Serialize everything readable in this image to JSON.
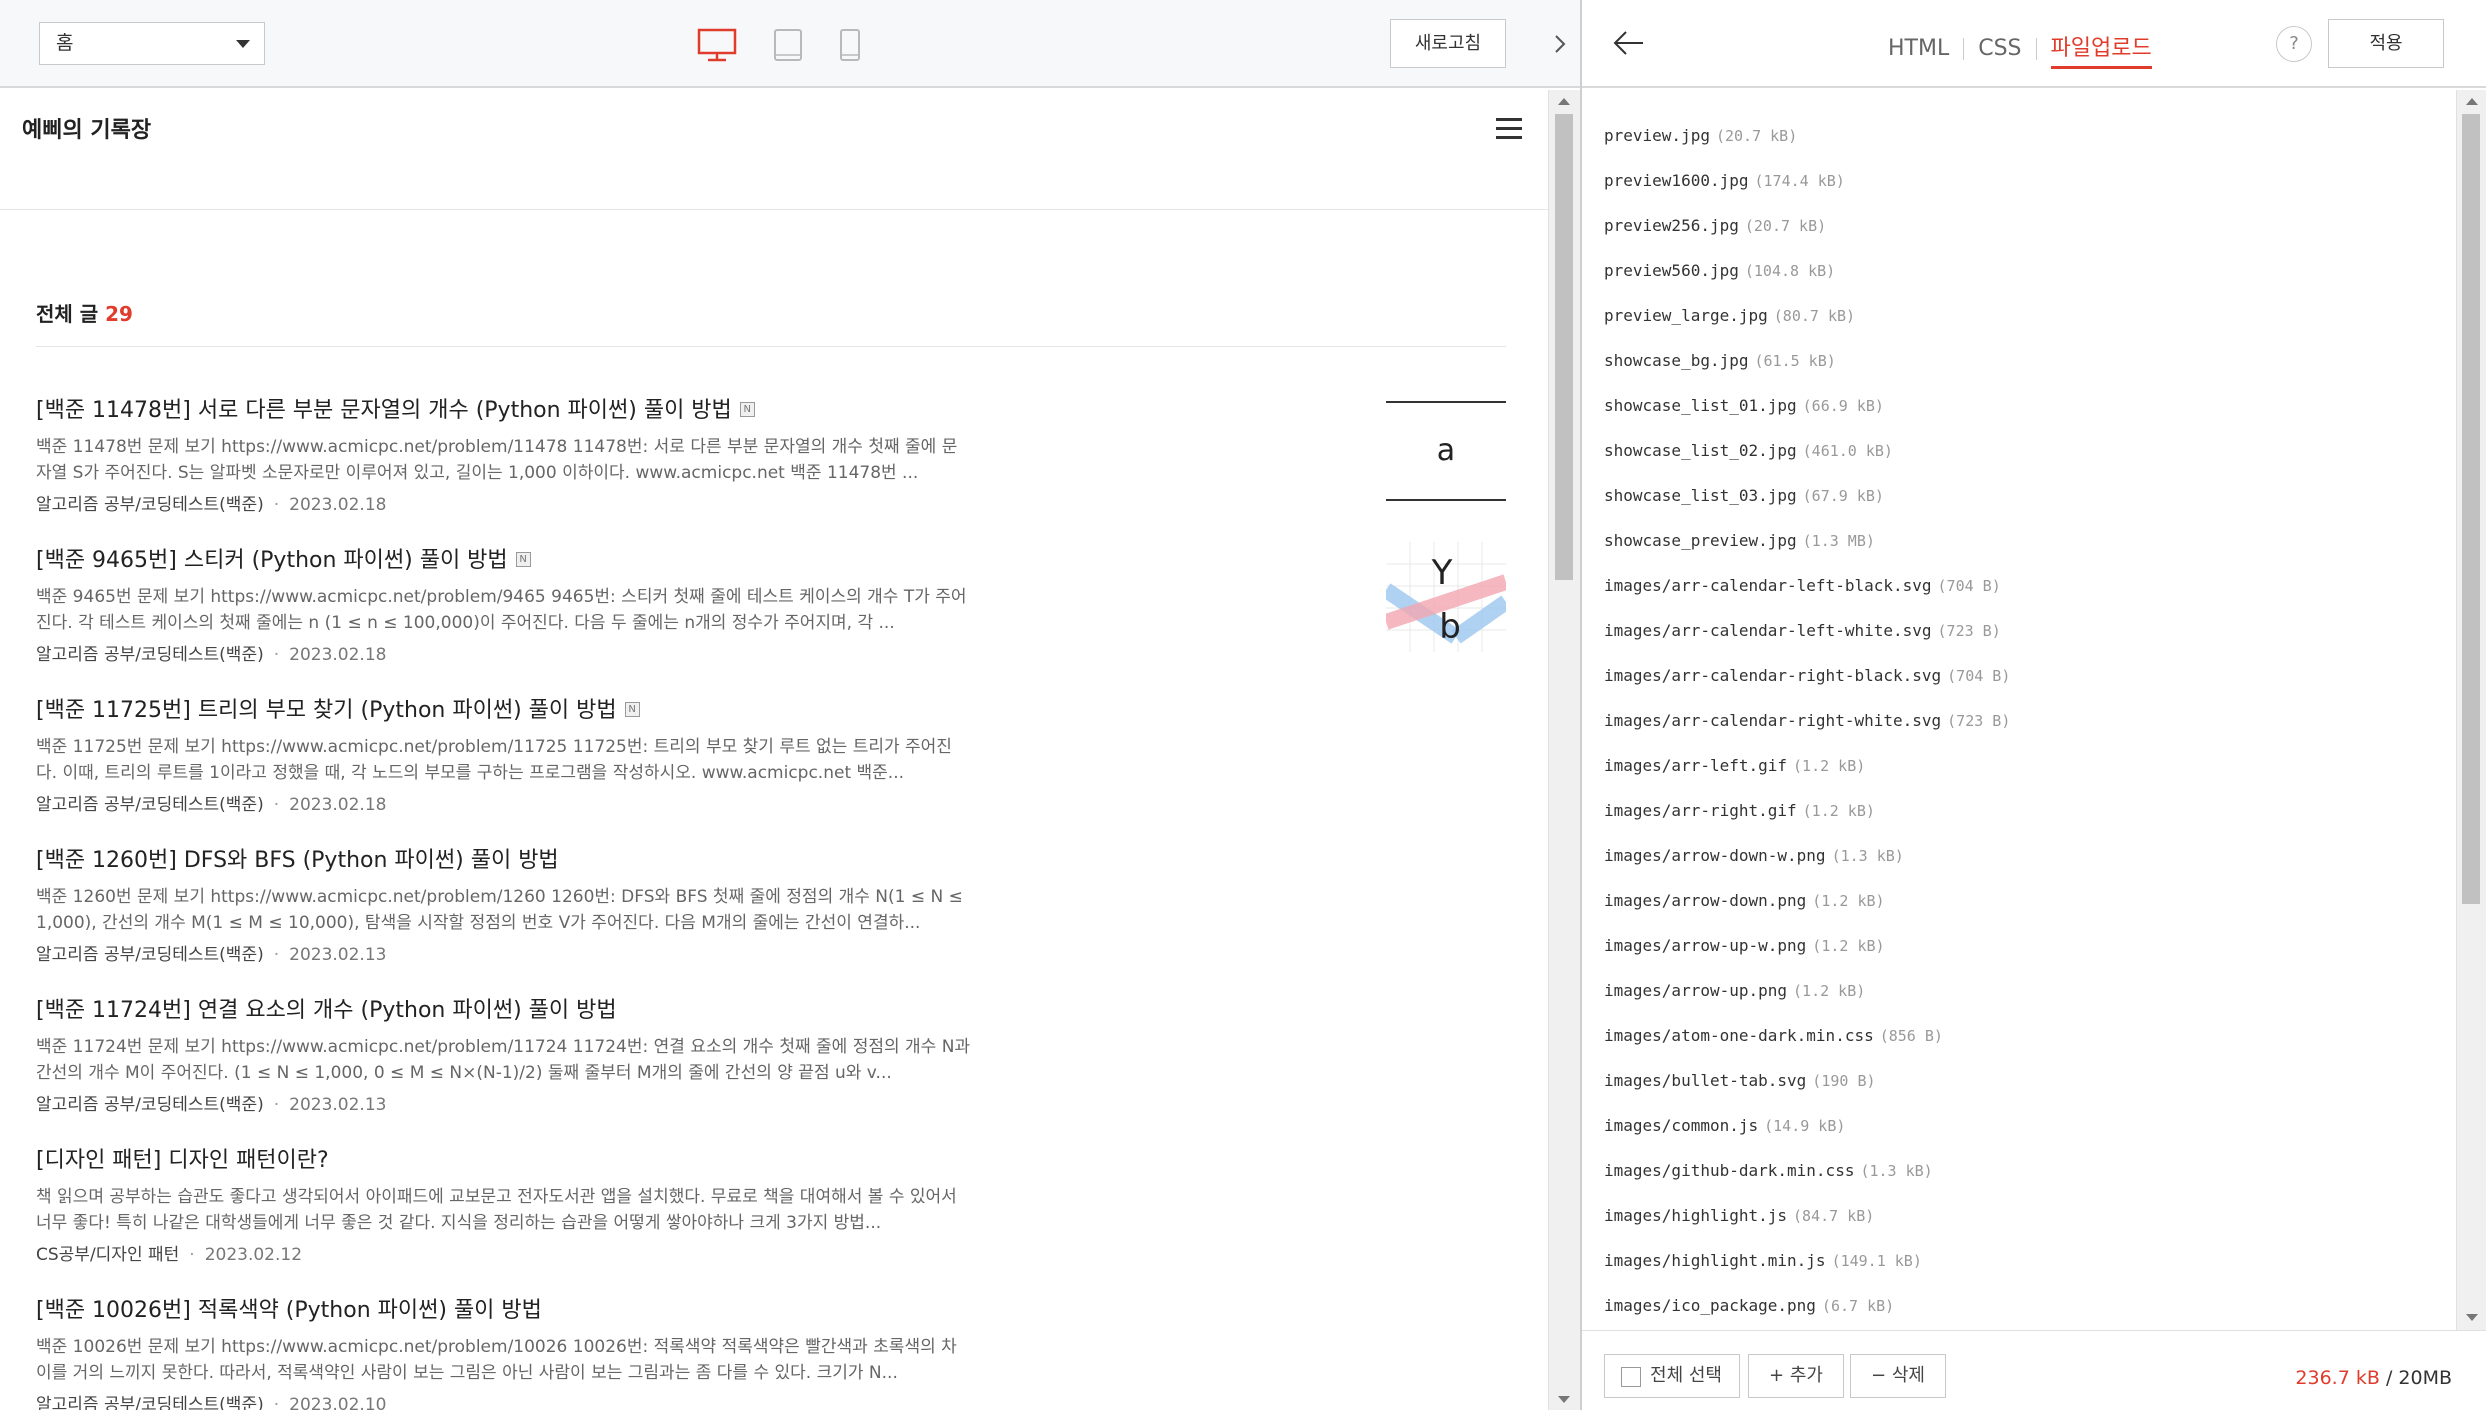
{
  "toolbar": {
    "page_select": "홈",
    "refresh_label": "새로고침"
  },
  "blog": {
    "title": "예삐의 기록장",
    "total_label": "전체 글",
    "total_count": "29",
    "posts": [
      {
        "title": "[백준 11478번] 서로 다른 부분 문자열의 개수 (Python 파이썬) 풀이 방법",
        "excerpt": "백준 11478번 문제 보기 https://www.acmicpc.net/problem/11478 11478번: 서로 다른 부분 문자열의 개수 첫째 줄에 문자열 S가 주어진다. S는 알파벳 소문자로만 이루어져 있고, 길이는 1,000 이하이다. www.acmicpc.net 백준 11478번 ...",
        "category": "알고리즘 공부/코딩테스트(백준)",
        "date": "2023.02.18",
        "new_badge": "N",
        "thumb_text": "a"
      },
      {
        "title": "[백준 9465번] 스티커 (Python 파이썬) 풀이 방법",
        "excerpt": "백준 9465번 문제 보기 https://www.acmicpc.net/problem/9465 9465번: 스티커 첫째 줄에 테스트 케이스의 개수 T가 주어진다. 각 테스트 케이스의 첫째 줄에는 n (1 ≤ n ≤ 100,000)이 주어진다. 다음 두 줄에는 n개의 정수가 주어지며, 각 ...",
        "category": "알고리즘 공부/코딩테스트(백준)",
        "date": "2023.02.18",
        "new_badge": "N",
        "thumb_top": "Y",
        "thumb_bottom": "b"
      },
      {
        "title": "[백준 11725번] 트리의 부모 찾기 (Python 파이썬) 풀이 방법",
        "excerpt": "백준 11725번 문제 보기 https://www.acmicpc.net/problem/11725 11725번: 트리의 부모 찾기 루트 없는 트리가 주어진다. 이때, 트리의 루트를 1이라고 정했을 때, 각 노드의 부모를 구하는 프로그램을 작성하시오. www.acmicpc.net 백준...",
        "category": "알고리즘 공부/코딩테스트(백준)",
        "date": "2023.02.18",
        "new_badge": "N"
      },
      {
        "title": "[백준 1260번] DFS와 BFS (Python 파이썬) 풀이 방법",
        "excerpt": "백준 1260번 문제 보기 https://www.acmicpc.net/problem/1260 1260번: DFS와 BFS 첫째 줄에 정점의 개수 N(1 ≤ N ≤ 1,000), 간선의 개수 M(1 ≤ M ≤ 10,000), 탐색을 시작할 정점의 번호 V가 주어진다. 다음 M개의 줄에는 간선이 연결하...",
        "category": "알고리즘 공부/코딩테스트(백준)",
        "date": "2023.02.13"
      },
      {
        "title": "[백준 11724번] 연결 요소의 개수 (Python 파이썬) 풀이 방법",
        "excerpt": "백준 11724번 문제 보기 https://www.acmicpc.net/problem/11724 11724번: 연결 요소의 개수 첫째 줄에 정점의 개수 N과 간선의 개수 M이 주어진다. (1 ≤ N ≤ 1,000, 0 ≤ M ≤ N×(N-1)/2) 둘째 줄부터 M개의 줄에 간선의 양 끝점 u와 v...",
        "category": "알고리즘 공부/코딩테스트(백준)",
        "date": "2023.02.13"
      },
      {
        "title": "[디자인 패턴] 디자인 패턴이란?",
        "excerpt": "책 읽으며 공부하는 습관도 좋다고 생각되어서 아이패드에 교보문고 전자도서관 앱을 설치했다. 무료로 책을 대여해서 볼 수 있어서 너무 좋다! 특히 나같은 대학생들에게 너무 좋은 것 같다. 지식을 정리하는 습관을 어떻게 쌓아야하나 크게 3가지 방법...",
        "category": "CS공부/디자인 패턴",
        "date": "2023.02.12"
      },
      {
        "title": "[백준 10026번] 적록색약 (Python 파이썬) 풀이 방법",
        "excerpt": "백준 10026번 문제 보기 https://www.acmicpc.net/problem/10026 10026번: 적록색약 적록색약은 빨간색과 초록색의 차이를 거의 느끼지 못한다. 따라서, 적록색약인 사람이 보는 그림은 아닌 사람이 보는 그림과는 좀 다를 수 있다. 크기가 N...",
        "category": "알고리즘 공부/코딩테스트(백준)",
        "date": "2023.02.10"
      }
    ]
  },
  "panel": {
    "tabs": [
      "HTML",
      "CSS",
      "파일업로드"
    ],
    "active_tab": "파일업로드",
    "help_label": "?",
    "apply_label": "적용",
    "files": [
      {
        "name": "preview.jpg",
        "size": "(20.7 kB)"
      },
      {
        "name": "preview1600.jpg",
        "size": "(174.4 kB)"
      },
      {
        "name": "preview256.jpg",
        "size": "(20.7 kB)"
      },
      {
        "name": "preview560.jpg",
        "size": "(104.8 kB)"
      },
      {
        "name": "preview_large.jpg",
        "size": "(80.7 kB)"
      },
      {
        "name": "showcase_bg.jpg",
        "size": "(61.5 kB)"
      },
      {
        "name": "showcase_list_01.jpg",
        "size": "(66.9 kB)"
      },
      {
        "name": "showcase_list_02.jpg",
        "size": "(461.0 kB)"
      },
      {
        "name": "showcase_list_03.jpg",
        "size": "(67.9 kB)"
      },
      {
        "name": "showcase_preview.jpg",
        "size": "(1.3 MB)"
      },
      {
        "name": "images/arr-calendar-left-black.svg",
        "size": "(704 B)"
      },
      {
        "name": "images/arr-calendar-left-white.svg",
        "size": "(723 B)"
      },
      {
        "name": "images/arr-calendar-right-black.svg",
        "size": "(704 B)"
      },
      {
        "name": "images/arr-calendar-right-white.svg",
        "size": "(723 B)"
      },
      {
        "name": "images/arr-left.gif",
        "size": "(1.2 kB)"
      },
      {
        "name": "images/arr-right.gif",
        "size": "(1.2 kB)"
      },
      {
        "name": "images/arrow-down-w.png",
        "size": "(1.3 kB)"
      },
      {
        "name": "images/arrow-down.png",
        "size": "(1.2 kB)"
      },
      {
        "name": "images/arrow-up-w.png",
        "size": "(1.2 kB)"
      },
      {
        "name": "images/arrow-up.png",
        "size": "(1.2 kB)"
      },
      {
        "name": "images/atom-one-dark.min.css",
        "size": "(856 B)"
      },
      {
        "name": "images/bullet-tab.svg",
        "size": "(190 B)"
      },
      {
        "name": "images/common.js",
        "size": "(14.9 kB)"
      },
      {
        "name": "images/github-dark.min.css",
        "size": "(1.3 kB)"
      },
      {
        "name": "images/highlight.js",
        "size": "(84.7 kB)"
      },
      {
        "name": "images/highlight.min.js",
        "size": "(149.1 kB)"
      },
      {
        "name": "images/ico_package.png",
        "size": "(6.7 kB)"
      }
    ],
    "footer": {
      "select_all_label": "전체 선택",
      "add_label": "+ 추가",
      "delete_label": "− 삭제",
      "used": "236.7 kB",
      "quota": " / 20MB"
    }
  },
  "colors": {
    "accent": "#e03c2c",
    "device_active": "#e03c2c",
    "device_inactive": "#b9b9b9"
  }
}
